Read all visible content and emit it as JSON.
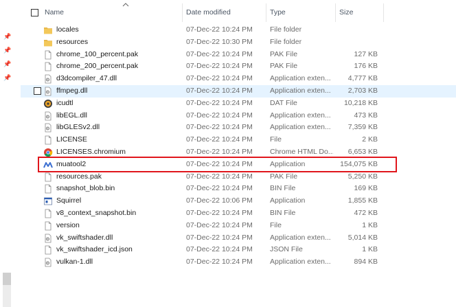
{
  "columns": {
    "name": "Name",
    "date": "Date modified",
    "type": "Type",
    "size": "Size"
  },
  "files": [
    {
      "name": "locales",
      "date": "07-Dec-22 10:24 PM",
      "type": "File folder",
      "size": "",
      "icon": "folder-icon"
    },
    {
      "name": "resources",
      "date": "07-Dec-22 10:30 PM",
      "type": "File folder",
      "size": "",
      "icon": "folder-icon"
    },
    {
      "name": "chrome_100_percent.pak",
      "date": "07-Dec-22 10:24 PM",
      "type": "PAK File",
      "size": "127 KB",
      "icon": "file-icon"
    },
    {
      "name": "chrome_200_percent.pak",
      "date": "07-Dec-22 10:24 PM",
      "type": "PAK File",
      "size": "176 KB",
      "icon": "file-icon"
    },
    {
      "name": "d3dcompiler_47.dll",
      "date": "07-Dec-22 10:24 PM",
      "type": "Application exten...",
      "size": "4,777 KB",
      "icon": "dll-icon"
    },
    {
      "name": "ffmpeg.dll",
      "date": "07-Dec-22 10:24 PM",
      "type": "Application exten...",
      "size": "2,703 KB",
      "icon": "dll-icon"
    },
    {
      "name": "icudtl",
      "date": "07-Dec-22 10:24 PM",
      "type": "DAT File",
      "size": "10,218 KB",
      "icon": "dat-icon"
    },
    {
      "name": "libEGL.dll",
      "date": "07-Dec-22 10:24 PM",
      "type": "Application exten...",
      "size": "473 KB",
      "icon": "dll-icon"
    },
    {
      "name": "libGLESv2.dll",
      "date": "07-Dec-22 10:24 PM",
      "type": "Application exten...",
      "size": "7,359 KB",
      "icon": "dll-icon"
    },
    {
      "name": "LICENSE",
      "date": "07-Dec-22 10:24 PM",
      "type": "File",
      "size": "2 KB",
      "icon": "file-icon"
    },
    {
      "name": "LICENSES.chromium",
      "date": "07-Dec-22 10:24 PM",
      "type": "Chrome HTML Do...",
      "size": "6,653 KB",
      "icon": "chrome-icon"
    },
    {
      "name": "muatool2",
      "date": "07-Dec-22 10:24 PM",
      "type": "Application",
      "size": "154,075 KB",
      "icon": "app-m-icon"
    },
    {
      "name": "resources.pak",
      "date": "07-Dec-22 10:24 PM",
      "type": "PAK File",
      "size": "5,250 KB",
      "icon": "file-icon"
    },
    {
      "name": "snapshot_blob.bin",
      "date": "07-Dec-22 10:24 PM",
      "type": "BIN File",
      "size": "169 KB",
      "icon": "file-icon"
    },
    {
      "name": "Squirrel",
      "date": "07-Dec-22 10:06 PM",
      "type": "Application",
      "size": "1,855 KB",
      "icon": "exe-icon"
    },
    {
      "name": "v8_context_snapshot.bin",
      "date": "07-Dec-22 10:24 PM",
      "type": "BIN File",
      "size": "472 KB",
      "icon": "file-icon"
    },
    {
      "name": "version",
      "date": "07-Dec-22 10:24 PM",
      "type": "File",
      "size": "1 KB",
      "icon": "file-icon"
    },
    {
      "name": "vk_swiftshader.dll",
      "date": "07-Dec-22 10:24 PM",
      "type": "Application exten...",
      "size": "5,014 KB",
      "icon": "dll-icon"
    },
    {
      "name": "vk_swiftshader_icd.json",
      "date": "07-Dec-22 10:24 PM",
      "type": "JSON File",
      "size": "1 KB",
      "icon": "file-icon"
    },
    {
      "name": "vulkan-1.dll",
      "date": "07-Dec-22 10:24 PM",
      "type": "Application exten...",
      "size": "894 KB",
      "icon": "dll-icon"
    }
  ],
  "hovered_row": "ffmpeg.dll",
  "highlighted_row": "muatool2",
  "colors": {
    "hover": "#e5f3ff",
    "highlight_border": "#e0151b",
    "folder": "#e8b74a"
  }
}
